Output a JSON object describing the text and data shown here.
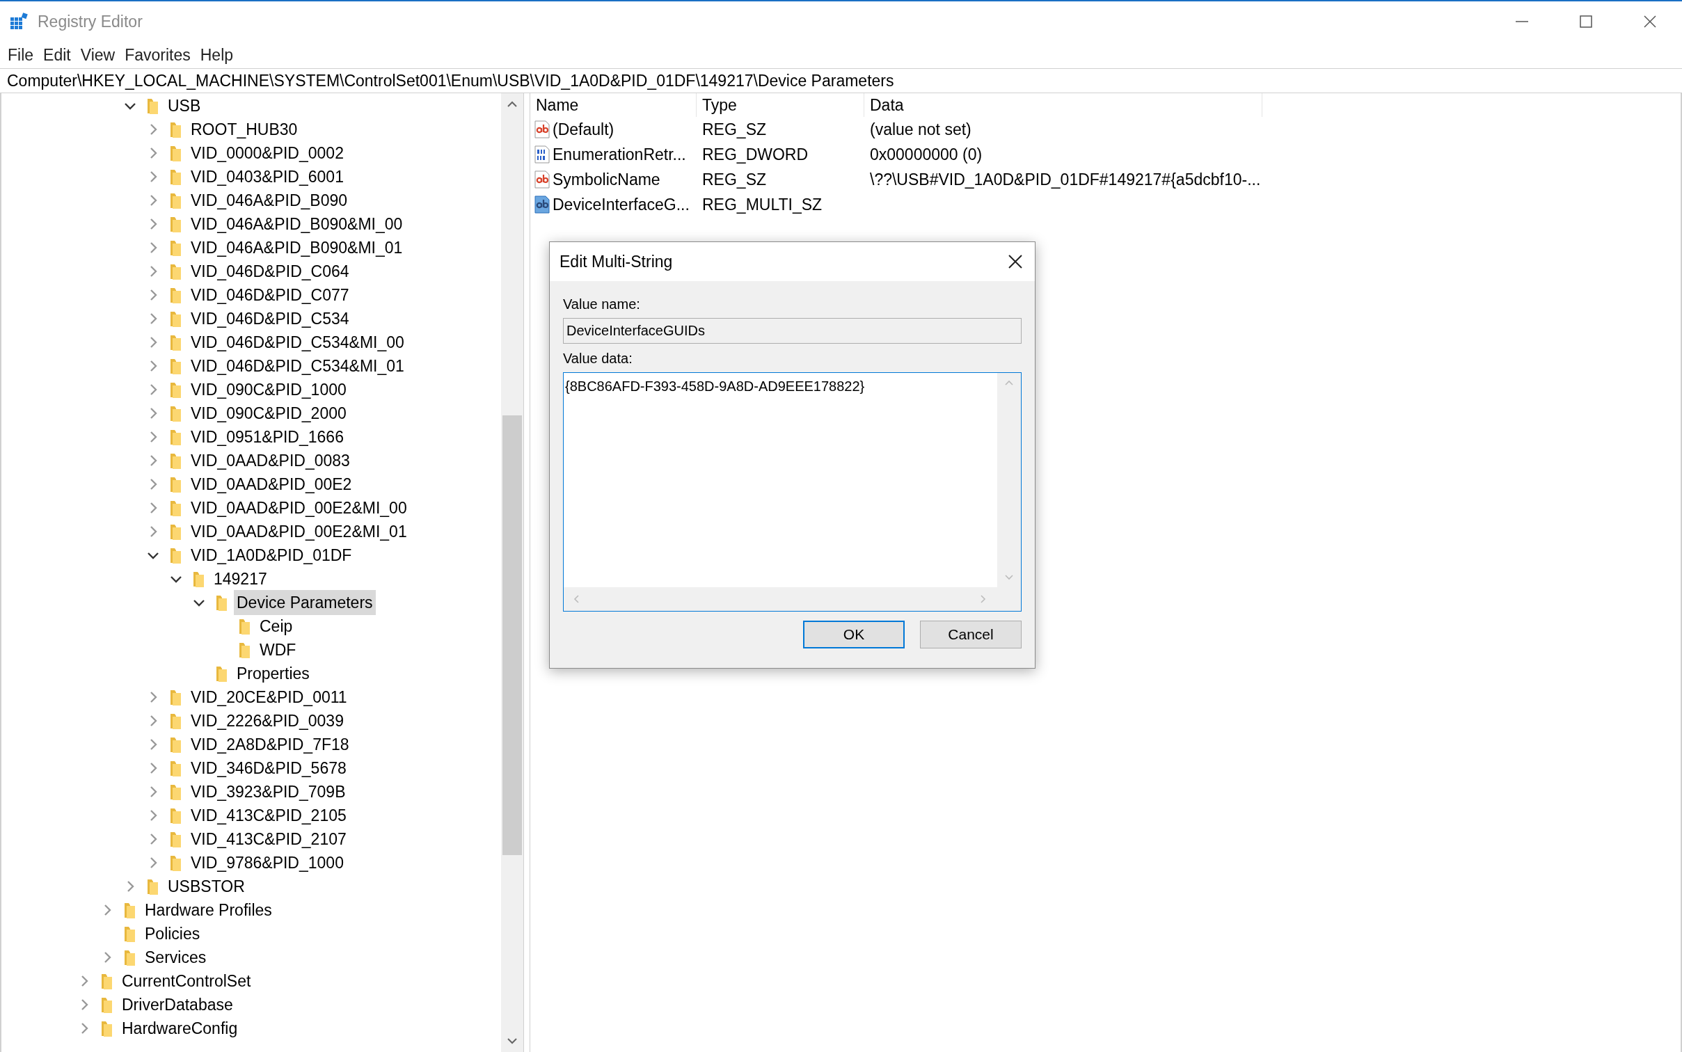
{
  "window": {
    "title": "Registry Editor"
  },
  "menu": [
    "File",
    "Edit",
    "View",
    "Favorites",
    "Help"
  ],
  "address": "Computer\\HKEY_LOCAL_MACHINE\\SYSTEM\\ControlSet001\\Enum\\USB\\VID_1A0D&PID_01DF\\149217\\Device Parameters",
  "tree": [
    {
      "children": [
        {
          "children": [
            {
              "label": "USB",
              "expanded": true,
              "selected": false,
              "children": [
                {
                  "label": "ROOT_HUB30",
                  "expanded": false,
                  "selected": false
                },
                {
                  "label": "VID_0000&PID_0002",
                  "expanded": false,
                  "selected": false
                },
                {
                  "label": "VID_0403&PID_6001",
                  "expanded": false,
                  "selected": false
                },
                {
                  "label": "VID_046A&PID_B090",
                  "expanded": false,
                  "selected": false
                },
                {
                  "label": "VID_046A&PID_B090&MI_00",
                  "expanded": false,
                  "selected": false
                },
                {
                  "label": "VID_046A&PID_B090&MI_01",
                  "expanded": false,
                  "selected": false
                },
                {
                  "label": "VID_046D&PID_C064",
                  "expanded": false,
                  "selected": false
                },
                {
                  "label": "VID_046D&PID_C077",
                  "expanded": false,
                  "selected": false
                },
                {
                  "label": "VID_046D&PID_C534",
                  "expanded": false,
                  "selected": false
                },
                {
                  "label": "VID_046D&PID_C534&MI_00",
                  "expanded": false,
                  "selected": false
                },
                {
                  "label": "VID_046D&PID_C534&MI_01",
                  "expanded": false,
                  "selected": false
                },
                {
                  "label": "VID_090C&PID_1000",
                  "expanded": false,
                  "selected": false
                },
                {
                  "label": "VID_090C&PID_2000",
                  "expanded": false,
                  "selected": false
                },
                {
                  "label": "VID_0951&PID_1666",
                  "expanded": false,
                  "selected": false
                },
                {
                  "label": "VID_0AAD&PID_0083",
                  "expanded": false,
                  "selected": false
                },
                {
                  "label": "VID_0AAD&PID_00E2",
                  "expanded": false,
                  "selected": false
                },
                {
                  "label": "VID_0AAD&PID_00E2&MI_00",
                  "expanded": false,
                  "selected": false
                },
                {
                  "label": "VID_0AAD&PID_00E2&MI_01",
                  "expanded": false,
                  "selected": false
                },
                {
                  "label": "VID_1A0D&PID_01DF",
                  "expanded": true,
                  "selected": false,
                  "children": [
                    {
                      "label": "149217",
                      "expanded": true,
                      "selected": false,
                      "children": [
                        {
                          "label": "Device Parameters",
                          "expanded": true,
                          "selected": true,
                          "children": [
                            {
                              "label": "Ceip",
                              "selected": false
                            },
                            {
                              "label": "WDF",
                              "selected": false
                            }
                          ]
                        },
                        {
                          "label": "Properties",
                          "selected": false
                        }
                      ]
                    }
                  ]
                },
                {
                  "label": "VID_20CE&PID_0011",
                  "expanded": false,
                  "selected": false
                },
                {
                  "label": "VID_2226&PID_0039",
                  "expanded": false,
                  "selected": false
                },
                {
                  "label": "VID_2A8D&PID_7F18",
                  "expanded": false,
                  "selected": false
                },
                {
                  "label": "VID_346D&PID_5678",
                  "expanded": false,
                  "selected": false
                },
                {
                  "label": "VID_3923&PID_709B",
                  "expanded": false,
                  "selected": false
                },
                {
                  "label": "VID_413C&PID_2105",
                  "expanded": false,
                  "selected": false
                },
                {
                  "label": "VID_413C&PID_2107",
                  "expanded": false,
                  "selected": false
                },
                {
                  "label": "VID_9786&PID_1000",
                  "expanded": false,
                  "selected": false
                }
              ]
            },
            {
              "label": "USBSTOR",
              "expanded": false,
              "selected": false
            }
          ]
        },
        {
          "label": "Hardware Profiles",
          "expanded": false,
          "selected": false
        },
        {
          "label": "Policies",
          "selected": false
        },
        {
          "label": "Services",
          "expanded": false,
          "selected": false
        }
      ]
    },
    {
      "label": "CurrentControlSet",
      "expanded": false,
      "selected": false
    },
    {
      "label": "DriverDatabase",
      "expanded": false,
      "selected": false
    },
    {
      "label": "HardwareConfig",
      "expanded": false,
      "selected": false
    }
  ],
  "columns": [
    "Name",
    "Type",
    "Data"
  ],
  "values": [
    {
      "kind": "string",
      "name": "(Default)",
      "type": "REG_SZ",
      "data": "(value not set)",
      "selected": false
    },
    {
      "kind": "binary",
      "name": "EnumerationRetr...",
      "type": "REG_DWORD",
      "data": "0x00000000 (0)",
      "selected": false
    },
    {
      "kind": "string",
      "name": "SymbolicName",
      "type": "REG_SZ",
      "data": "\\??\\USB#VID_1A0D&PID_01DF#149217#{a5dcbf10-...",
      "selected": false
    },
    {
      "kind": "string",
      "name": "DeviceInterfaceG...",
      "type": "REG_MULTI_SZ",
      "selected": true
    }
  ],
  "dialog": {
    "title": "Edit Multi-String",
    "value_name_label": "Value name:",
    "value_name": "DeviceInterfaceGUIDs",
    "value_data_label": "Value data:",
    "value_data": "{8BC86AFD-F393-458D-9A8D-AD9EEE178822}",
    "buttons": [
      {
        "label": "OK",
        "focused": true
      },
      {
        "label": "Cancel",
        "focused": false
      }
    ]
  }
}
